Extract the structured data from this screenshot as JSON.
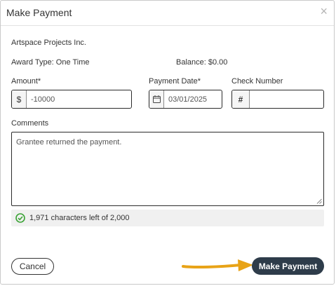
{
  "dialog": {
    "title": "Make Payment",
    "close_glyph": "×"
  },
  "info": {
    "organization": "Artspace Projects Inc.",
    "award_type": "Award Type: One Time",
    "balance": "Balance: $0.00"
  },
  "form": {
    "amount_label": "Amount*",
    "amount_prefix": "$",
    "amount_value": "-10000",
    "payment_date_label": "Payment Date*",
    "payment_date_value": "03/01/2025",
    "check_number_label": "Check Number",
    "check_number_prefix": "#",
    "check_number_value": "",
    "comments_label": "Comments",
    "comments_value": "Grantee returned the payment."
  },
  "counter": {
    "text": "1,971 characters left of 2,000",
    "icon": "check-circle-icon",
    "color": "#3aa335"
  },
  "footer": {
    "cancel_label": "Cancel",
    "submit_label": "Make Payment",
    "submit_color": "#2e3c4a",
    "arrow_color": "#e8a317"
  }
}
